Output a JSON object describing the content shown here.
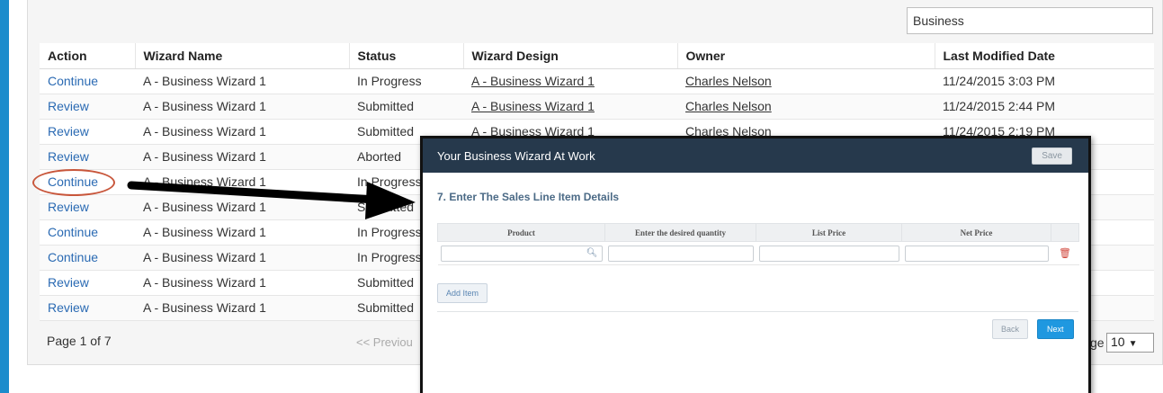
{
  "search": {
    "value": "Business"
  },
  "table": {
    "headers": [
      "Action",
      "Wizard Name",
      "Status",
      "Wizard Design",
      "Owner",
      "Last Modified Date"
    ],
    "rows": [
      [
        "Continue",
        "A - Business Wizard 1",
        "In Progress",
        "A - Business Wizard 1",
        "Charles Nelson",
        "11/24/2015 3:03 PM"
      ],
      [
        "Review",
        "A - Business Wizard 1",
        "Submitted",
        "A - Business Wizard 1",
        "Charles Nelson",
        "11/24/2015 2:44 PM"
      ],
      [
        "Review",
        "A - Business Wizard 1",
        "Submitted",
        "A - Business Wizard 1",
        "Charles Nelson",
        "11/24/2015 2:19 PM"
      ],
      [
        "Review",
        "A - Business Wizard 1",
        "Aborted",
        "",
        "",
        ""
      ],
      [
        "Continue",
        "A - Business Wizard 1",
        "In Progress",
        "",
        "",
        ""
      ],
      [
        "Review",
        "A - Business Wizard 1",
        "Submitted",
        "",
        "",
        ""
      ],
      [
        "Continue",
        "A - Business Wizard 1",
        "In Progress",
        "",
        "",
        ""
      ],
      [
        "Continue",
        "A - Business Wizard 1",
        "In Progress",
        "",
        "",
        ""
      ],
      [
        "Review",
        "A - Business Wizard 1",
        "Submitted",
        "",
        "",
        ""
      ],
      [
        "Review",
        "A - Business Wizard 1",
        "Submitted",
        "",
        "",
        ""
      ]
    ]
  },
  "pager": {
    "page_info": "Page 1 of 7",
    "previous": "<< Previou",
    "page_size_label": "ge",
    "page_size": "10"
  },
  "modal": {
    "title": "Your Business Wizard At Work",
    "save": "Save",
    "step_title": "7. Enter The Sales Line Item Details",
    "columns": [
      "Product",
      "Enter the desired quantity",
      "List Price",
      "Net Price"
    ],
    "add_item": "Add Item",
    "back": "Back",
    "next": "Next"
  },
  "colors": {
    "accent": "#1b8ccc",
    "modal_header": "#26394c",
    "next_button": "#1f98e0",
    "highlight_circle": "#c8563b"
  }
}
